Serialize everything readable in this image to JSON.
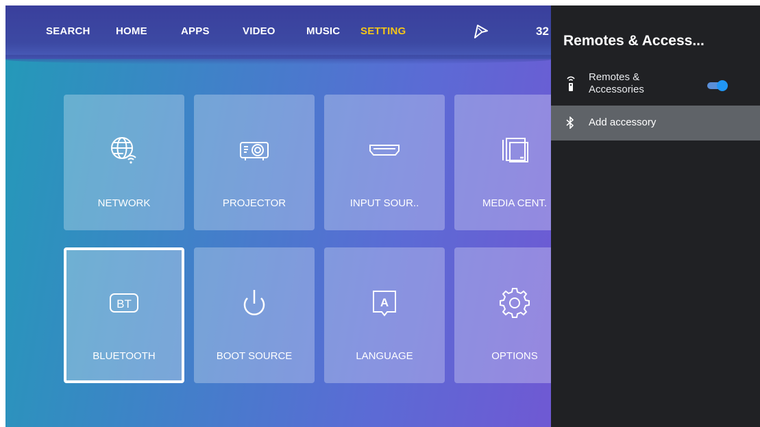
{
  "nav": {
    "items": [
      {
        "label": "SEARCH"
      },
      {
        "label": "HOME"
      },
      {
        "label": "APPS"
      },
      {
        "label": "VIDEO"
      },
      {
        "label": "MUSIC"
      },
      {
        "label": "SETTING",
        "active": true
      }
    ],
    "clock": "32",
    "pointer_icon": "mouse-pointer-icon"
  },
  "tiles": [
    {
      "label": "NETWORK",
      "icon": "globe-wifi-icon"
    },
    {
      "label": "PROJECTOR",
      "icon": "projector-icon"
    },
    {
      "label": "INPUT SOUR..",
      "icon": "hdmi-icon"
    },
    {
      "label": "MEDIA CENT.",
      "icon": "folder-icon"
    },
    {
      "label": "BLUETOOTH",
      "icon": "bluetooth-bt-icon",
      "focused": true
    },
    {
      "label": "BOOT SOURCE",
      "icon": "power-icon"
    },
    {
      "label": "LANGUAGE",
      "icon": "language-icon"
    },
    {
      "label": "OPTIONS",
      "icon": "gear-icon"
    }
  ],
  "panel": {
    "title": "Remotes & Access...",
    "remotes_row": {
      "label": "Remotes & Accessories",
      "icon": "remote-icon",
      "toggle_on": true
    },
    "add_row": {
      "label": "Add accessory",
      "icon": "bluetooth-icon"
    }
  },
  "colors": {
    "accent_active_nav": "#f5c518",
    "toggle": "#2196f3",
    "panel_bg": "#202124",
    "selected_row": "#5f6368"
  }
}
